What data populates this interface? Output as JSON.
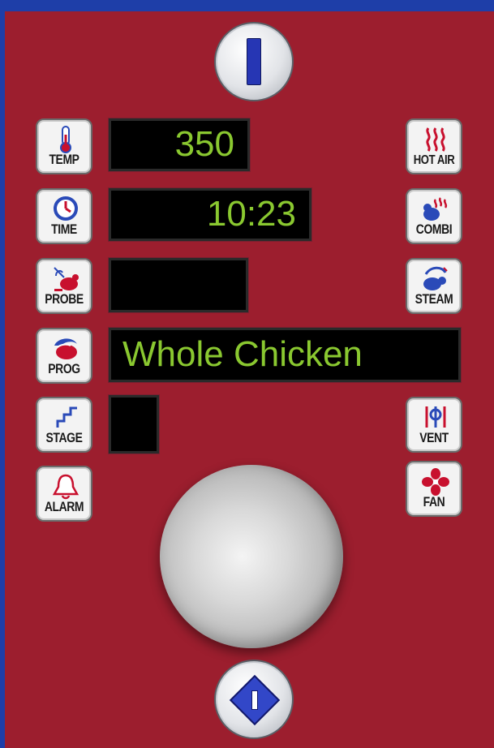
{
  "buttons_left": {
    "temp": "TEMP",
    "time": "TIME",
    "probe": "PROBE",
    "prog": "PROG",
    "stage": "STAGE",
    "alarm": "ALARM"
  },
  "buttons_right": {
    "hot_air": "HOT AIR",
    "combi": "COMBI",
    "steam": "STEAM",
    "vent": "VENT",
    "fan": "FAN"
  },
  "displays": {
    "temperature": "350",
    "time": "10:23",
    "probe": "",
    "program": "Whole Chicken",
    "stage": ""
  },
  "colors": {
    "panel": "#9c1e2e",
    "frame": "#1e3ea8",
    "display_text": "#8ac830",
    "icon_red": "#c8102e",
    "icon_blue": "#2a4ab8"
  }
}
